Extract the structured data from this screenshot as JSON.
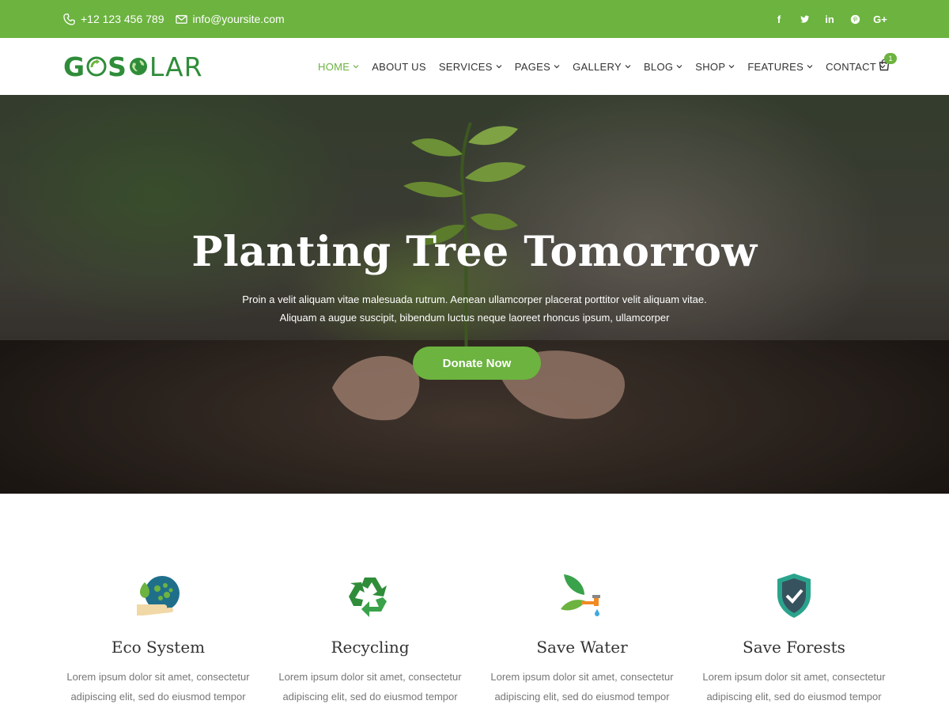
{
  "topbar": {
    "phone": "+12 123 456 789",
    "email": "info@yoursite.com",
    "social": [
      {
        "icon": "facebook-icon",
        "glyph": "f"
      },
      {
        "icon": "twitter-icon",
        "glyph": "t"
      },
      {
        "icon": "linkedin-icon",
        "glyph": "in"
      },
      {
        "icon": "pinterest-icon",
        "glyph": "p"
      },
      {
        "icon": "google-plus-icon",
        "glyph": "G+"
      }
    ]
  },
  "logo": {
    "text_left": "G",
    "text_mid": "S",
    "text_right": "LAR"
  },
  "nav": {
    "items": [
      {
        "label": "HOME",
        "active": true
      },
      {
        "label": "ABOUT US"
      },
      {
        "label": "SERVICES"
      },
      {
        "label": "PAGES"
      },
      {
        "label": "GALLERY"
      },
      {
        "label": "BLOG"
      },
      {
        "label": "SHOP"
      },
      {
        "label": "FEATURES"
      },
      {
        "label": "CONTACT"
      }
    ],
    "cart_count": "1"
  },
  "hero": {
    "title": "Planting Tree Tomorrow",
    "subtitle_line1": "Proin a velit aliquam vitae malesuada rutrum. Aenean ullamcorper placerat porttitor velit aliquam vitae.",
    "subtitle_line2": "Aliquam a augue suscipit, bibendum luctus neque laoreet rhoncus ipsum, ullamcorper",
    "cta": "Donate Now"
  },
  "features": [
    {
      "title": "Eco System",
      "icon": "eco-system-icon",
      "text": "Lorem ipsum dolor sit amet, consectetur adipiscing elit, sed do eiusmod tempor"
    },
    {
      "title": "Recycling",
      "icon": "recycling-icon",
      "text": "Lorem ipsum dolor sit amet, consectetur adipiscing elit, sed do eiusmod tempor"
    },
    {
      "title": "Save Water",
      "icon": "save-water-icon",
      "text": "Lorem ipsum dolor sit amet, consectetur adipiscing elit, sed do eiusmod tempor"
    },
    {
      "title": "Save Forests",
      "icon": "shield-check-icon",
      "text": "Lorem ipsum dolor sit amet, consectetur adipiscing elit, sed do eiusmod tempor"
    }
  ],
  "colors": {
    "accent": "#6cb33f",
    "logo_green": "#2f8d3a",
    "text_dark": "#333333",
    "text_muted": "#777777"
  }
}
